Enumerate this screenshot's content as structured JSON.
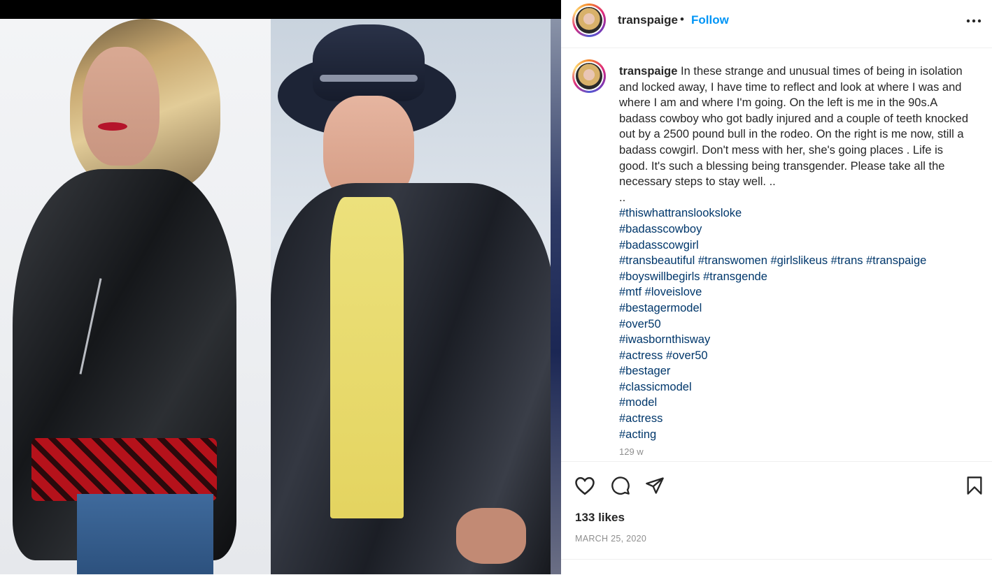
{
  "post": {
    "username": "transpaige",
    "separator": "•",
    "follow_label": "Follow",
    "caption_text": "In these strange and unusual times of being in isolation and locked away, I have time to reflect and look at where I was and where I am and where I'm going. On the left is me in the 90s.A badass cowboy who got badly injured and a couple of teeth knocked out by a 2500 pound bull in the rodeo. On the right is me now, still a badass cowgirl. Don't mess with her, she's going places . Life is good. It's such a blessing being transgender. Please take all the necessary steps to stay well. ..",
    "caption_dots": "..",
    "hashtag_lines": [
      "#thiswhattranslooksloke",
      "#badasscowboy",
      "#badasscowgirl",
      "#transbeautiful #transwomen #girlslikeus #trans #transpaige",
      "#boyswillbegirls #transgende",
      "#mtf #loveislove",
      "#bestagermodel",
      "#over50",
      "#iwasbornthisway",
      "#actress #over50",
      "#bestager",
      "#classicmodel",
      "#model",
      "#actress",
      "#acting"
    ],
    "age": "129 w",
    "likes": "133 likes",
    "date": "MARCH 25, 2020"
  },
  "icons": {
    "more": "more-options-icon",
    "like": "heart-icon",
    "comment": "comment-icon",
    "share": "paper-plane-icon",
    "save": "bookmark-icon"
  },
  "colors": {
    "follow": "#0095f6",
    "hashtag": "#00376b",
    "muted": "#8e8e8e",
    "text": "#262626"
  }
}
